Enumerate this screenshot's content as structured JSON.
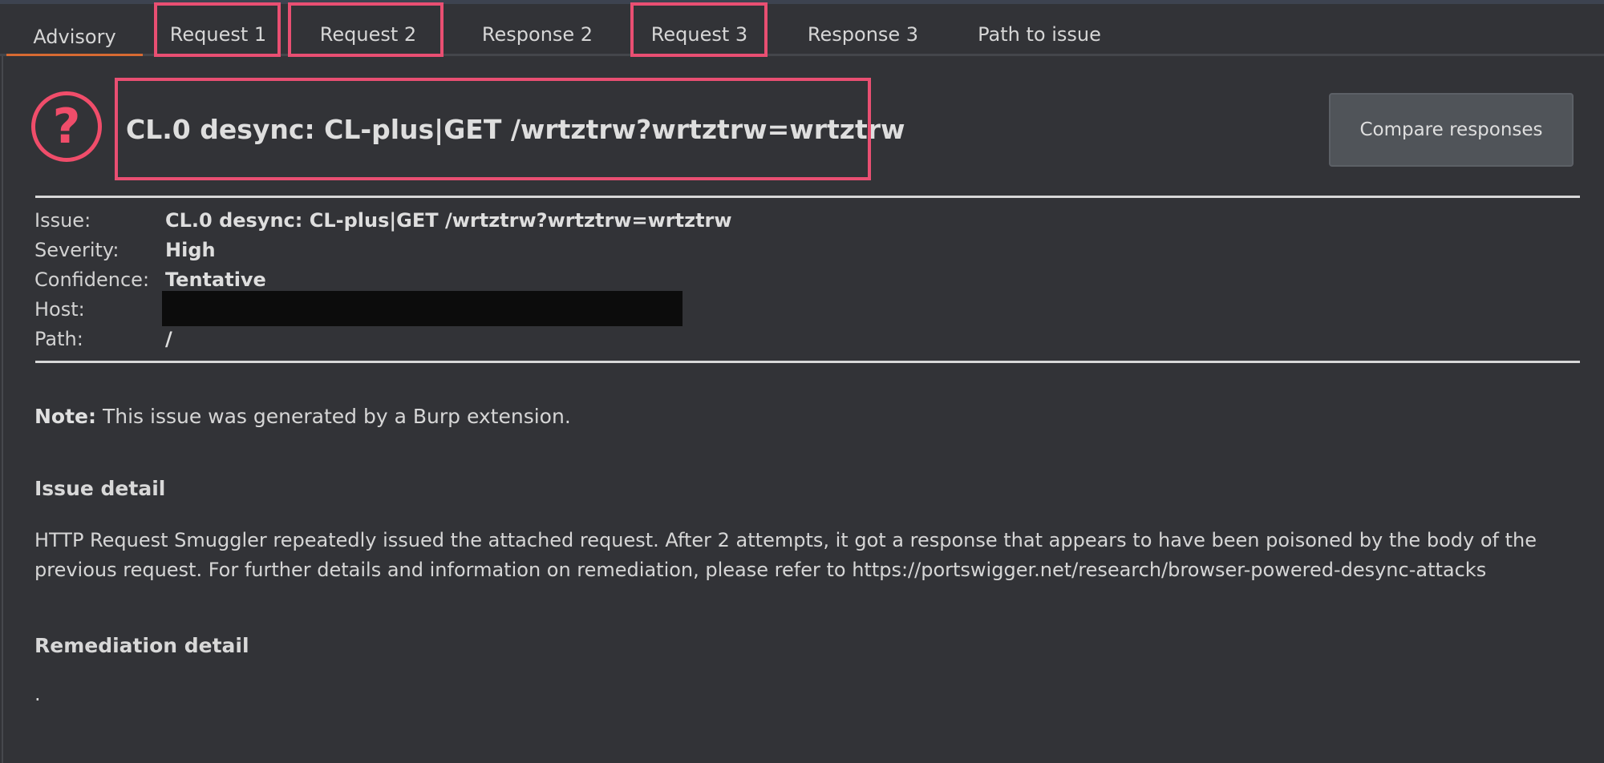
{
  "tabs": [
    {
      "label": "Advisory"
    },
    {
      "label": "Request 1"
    },
    {
      "label": "Request 2"
    },
    {
      "label": "Response 2"
    },
    {
      "label": "Request 3"
    },
    {
      "label": "Response 3"
    },
    {
      "label": "Path to issue"
    }
  ],
  "header": {
    "icon": "question-icon",
    "icon_glyph": "?",
    "title": "CL.0 desync: CL-plus|GET /wrtztrw?wrtztrw=wrtztrw",
    "compare_button": "Compare responses"
  },
  "meta": {
    "issue_label": "Issue:",
    "issue_value": "CL.0 desync: CL-plus|GET /wrtztrw?wrtztrw=wrtztrw",
    "severity_label": "Severity:",
    "severity_value": "High",
    "confidence_label": "Confidence:",
    "confidence_value": "Tentative",
    "host_label": "Host:",
    "path_label": "Path:",
    "path_value": "/"
  },
  "note": {
    "prefix": "Note:",
    "text": " This issue was generated by a Burp extension."
  },
  "issue_detail": {
    "heading": "Issue detail",
    "text": "HTTP Request Smuggler repeatedly issued the attached request. After 2 attempts, it got a response that appears to have been poisoned by the body of the previous request. For further details and information on remediation, please refer to https://portswigger.net/research/browser-powered-desync-attacks"
  },
  "remediation_detail": {
    "heading": "Remediation detail",
    "text": "."
  },
  "colors": {
    "background": "#323337",
    "highlight": "#e94f72",
    "active_tab_underline": "#d86a32",
    "severity_icon": "#f04d6a"
  }
}
